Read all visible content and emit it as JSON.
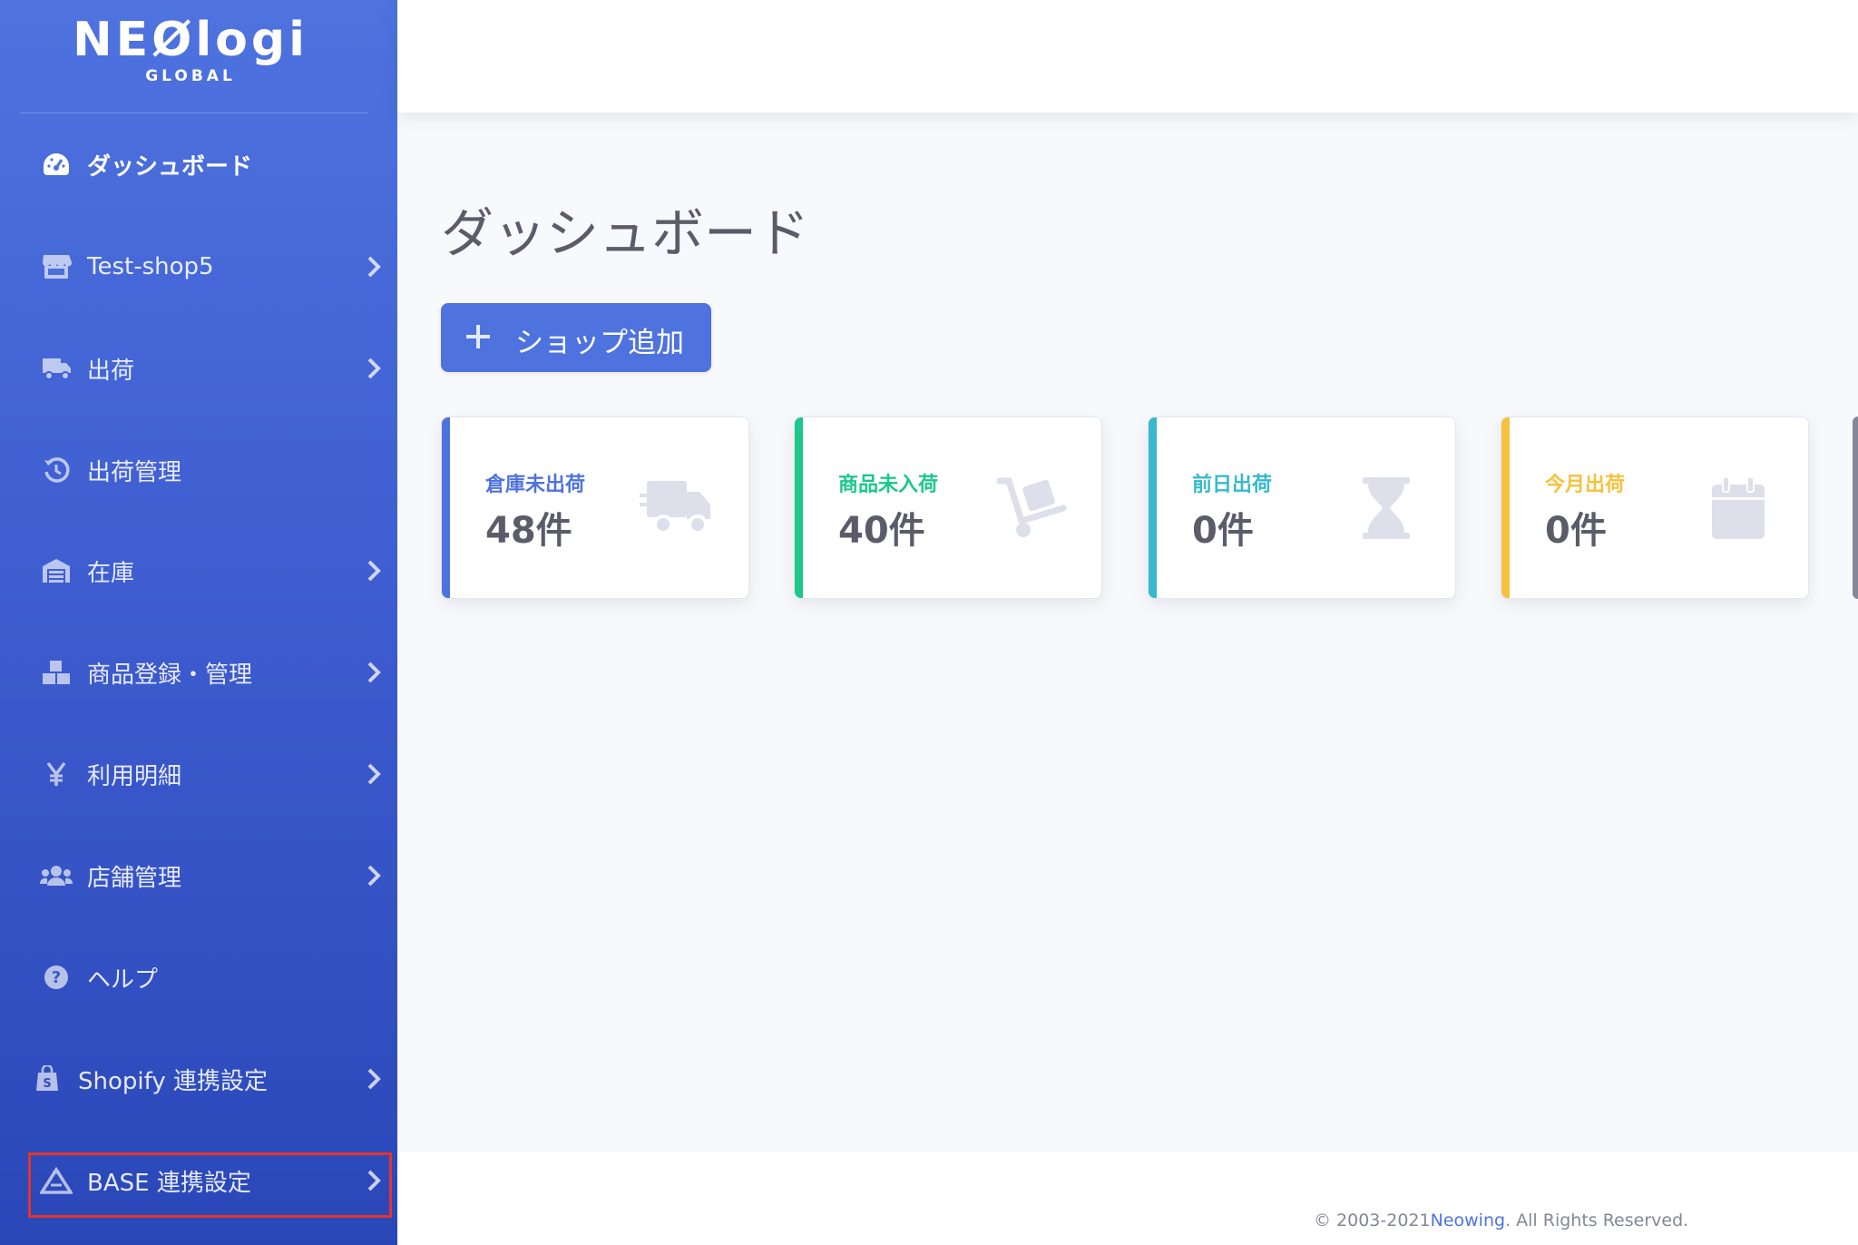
{
  "brand": {
    "name": "NEØlogi",
    "sub": "GLOBAL"
  },
  "sidebar": {
    "items": [
      {
        "label": "ダッシュボード",
        "icon": "tachometer-icon",
        "chevron": false,
        "active": true
      },
      {
        "label": "Test-shop5",
        "icon": "store-icon",
        "chevron": true
      },
      {
        "label": "出荷",
        "icon": "truck-icon",
        "chevron": true
      },
      {
        "label": "出荷管理",
        "icon": "history-icon",
        "chevron": false
      },
      {
        "label": "在庫",
        "icon": "warehouse-icon",
        "chevron": true
      },
      {
        "label": "商品登録・管理",
        "icon": "boxes-icon",
        "chevron": true
      },
      {
        "label": "利用明細",
        "icon": "yen-icon",
        "chevron": true
      },
      {
        "label": "店舗管理",
        "icon": "users-icon",
        "chevron": true
      },
      {
        "label": "ヘルプ",
        "icon": "question-circle-icon",
        "chevron": false
      },
      {
        "label": "Shopify 連携設定",
        "icon": "shopify-bag-icon",
        "chevron": true
      },
      {
        "label": "BASE 連携設定",
        "icon": "base-icon",
        "chevron": true,
        "highlighted": true
      }
    ]
  },
  "main": {
    "title": "ダッシュボード",
    "add_shop_label": "ショップ追加",
    "cards": [
      {
        "label": "倉庫未出荷",
        "value": "48件",
        "color": "#4e73df",
        "icon": "shipping-fast-icon"
      },
      {
        "label": "商品未入荷",
        "value": "40件",
        "color": "#1cc88a",
        "icon": "dolly-icon"
      },
      {
        "label": "前日出荷",
        "value": "0件",
        "color": "#36b9cc",
        "icon": "hourglass-icon"
      },
      {
        "label": "今月出荷",
        "value": "0件",
        "color": "#f6c23e",
        "icon": "calendar-icon"
      }
    ]
  },
  "footer": {
    "prefix": "© 2003-2021",
    "link": "Neowing",
    "suffix": ". All Rights Reserved."
  },
  "colors": {
    "primary": "#4e73df",
    "success": "#1cc88a",
    "info": "#36b9cc",
    "warning": "#f6c23e",
    "highlight": "#e5342b"
  }
}
